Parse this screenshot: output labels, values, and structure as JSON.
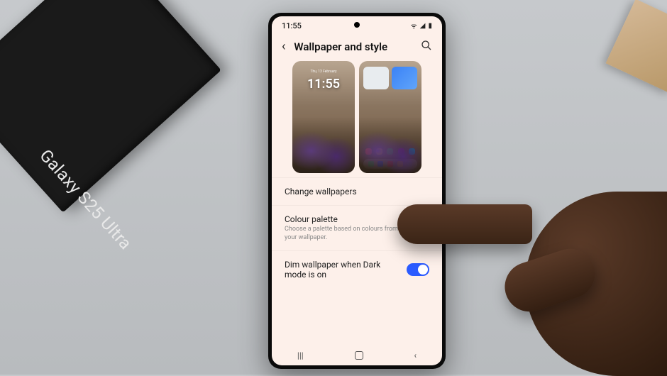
{
  "product_box": {
    "label": "Galaxy S25 Ultra"
  },
  "statusbar": {
    "time": "11:55"
  },
  "header": {
    "title": "Wallpaper and style"
  },
  "previews": {
    "lock": {
      "time": "11:55",
      "date": "Thu, 13 February"
    }
  },
  "items": {
    "change": {
      "title": "Change wallpapers"
    },
    "palette": {
      "title": "Colour palette",
      "sub": "Choose a palette based on colours from your wallpaper."
    },
    "dim": {
      "title": "Dim wallpaper when Dark mode is on"
    }
  }
}
